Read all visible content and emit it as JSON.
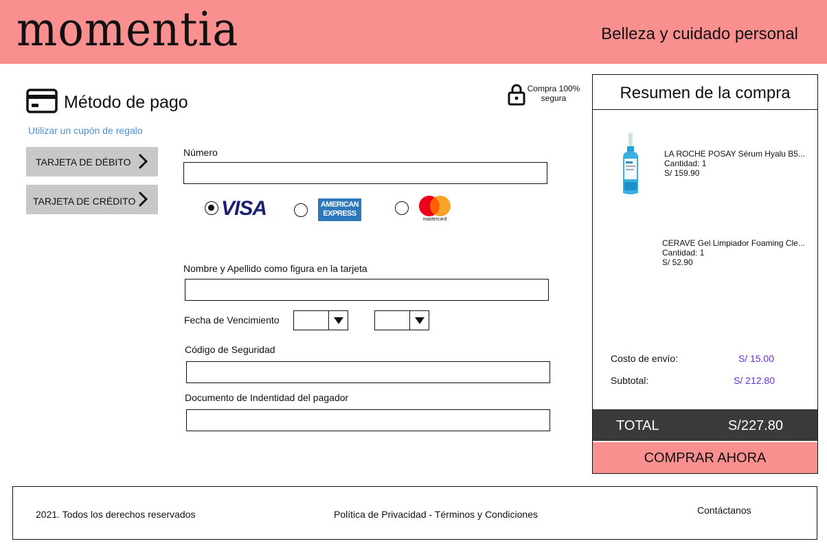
{
  "header": {
    "logo": "momentia",
    "tagline": "Belleza y cuidado personal"
  },
  "payment": {
    "title": "Método de pago",
    "coupon_link": "Utilizar un cupón de regalo",
    "secure_line1": "Compra 100%",
    "secure_line2": "segura",
    "methods": [
      {
        "label": "TARJETA DE DÉBITO"
      },
      {
        "label": "TARJETA DE CRÉDITO"
      }
    ],
    "number_label": "Número",
    "brands": {
      "visa": "VISA",
      "amex_line1": "AMERICAN",
      "amex_line2": "EXPRESS",
      "mastercard": "mastercard",
      "selected": "visa"
    },
    "name_label": "Nombre y Apellido como figura en la tarjeta",
    "expiry_label": "Fecha de Vencimiento",
    "cvv_label": "Código de Seguridad",
    "document_label": "Documento de Indentidad del pagador"
  },
  "summary": {
    "title": "Resumen de la compra",
    "products": [
      {
        "name": "LA ROCHE POSAY Sérum Hyalu B5...",
        "qty": "Cantidad: 1",
        "price": "S/ 159.90"
      },
      {
        "name": "CERAVE Gel Limpiador Foaming Cle...",
        "qty": "Cantidad: 1",
        "price": "S/ 52.90"
      }
    ],
    "shipping_label": "Costo de envío:",
    "shipping_value": "S/ 15.00",
    "subtotal_label": "Subtotal:",
    "subtotal_value": "S/ 212.80",
    "total_label": "TOTAL",
    "total_value": "S/227.80",
    "buy_label": "COMPRAR AHORA"
  },
  "footer": {
    "copyright": "2021. Todos los derechos reservados",
    "policy": "Política de Privacidad - Términos y Condiciones",
    "contact": "Contáctanos"
  },
  "colors": {
    "brand_pink": "#fa8f8f",
    "link_blue": "#4a90d9",
    "price_purple": "#6a2bd9",
    "total_bar": "#3a3a3a"
  }
}
